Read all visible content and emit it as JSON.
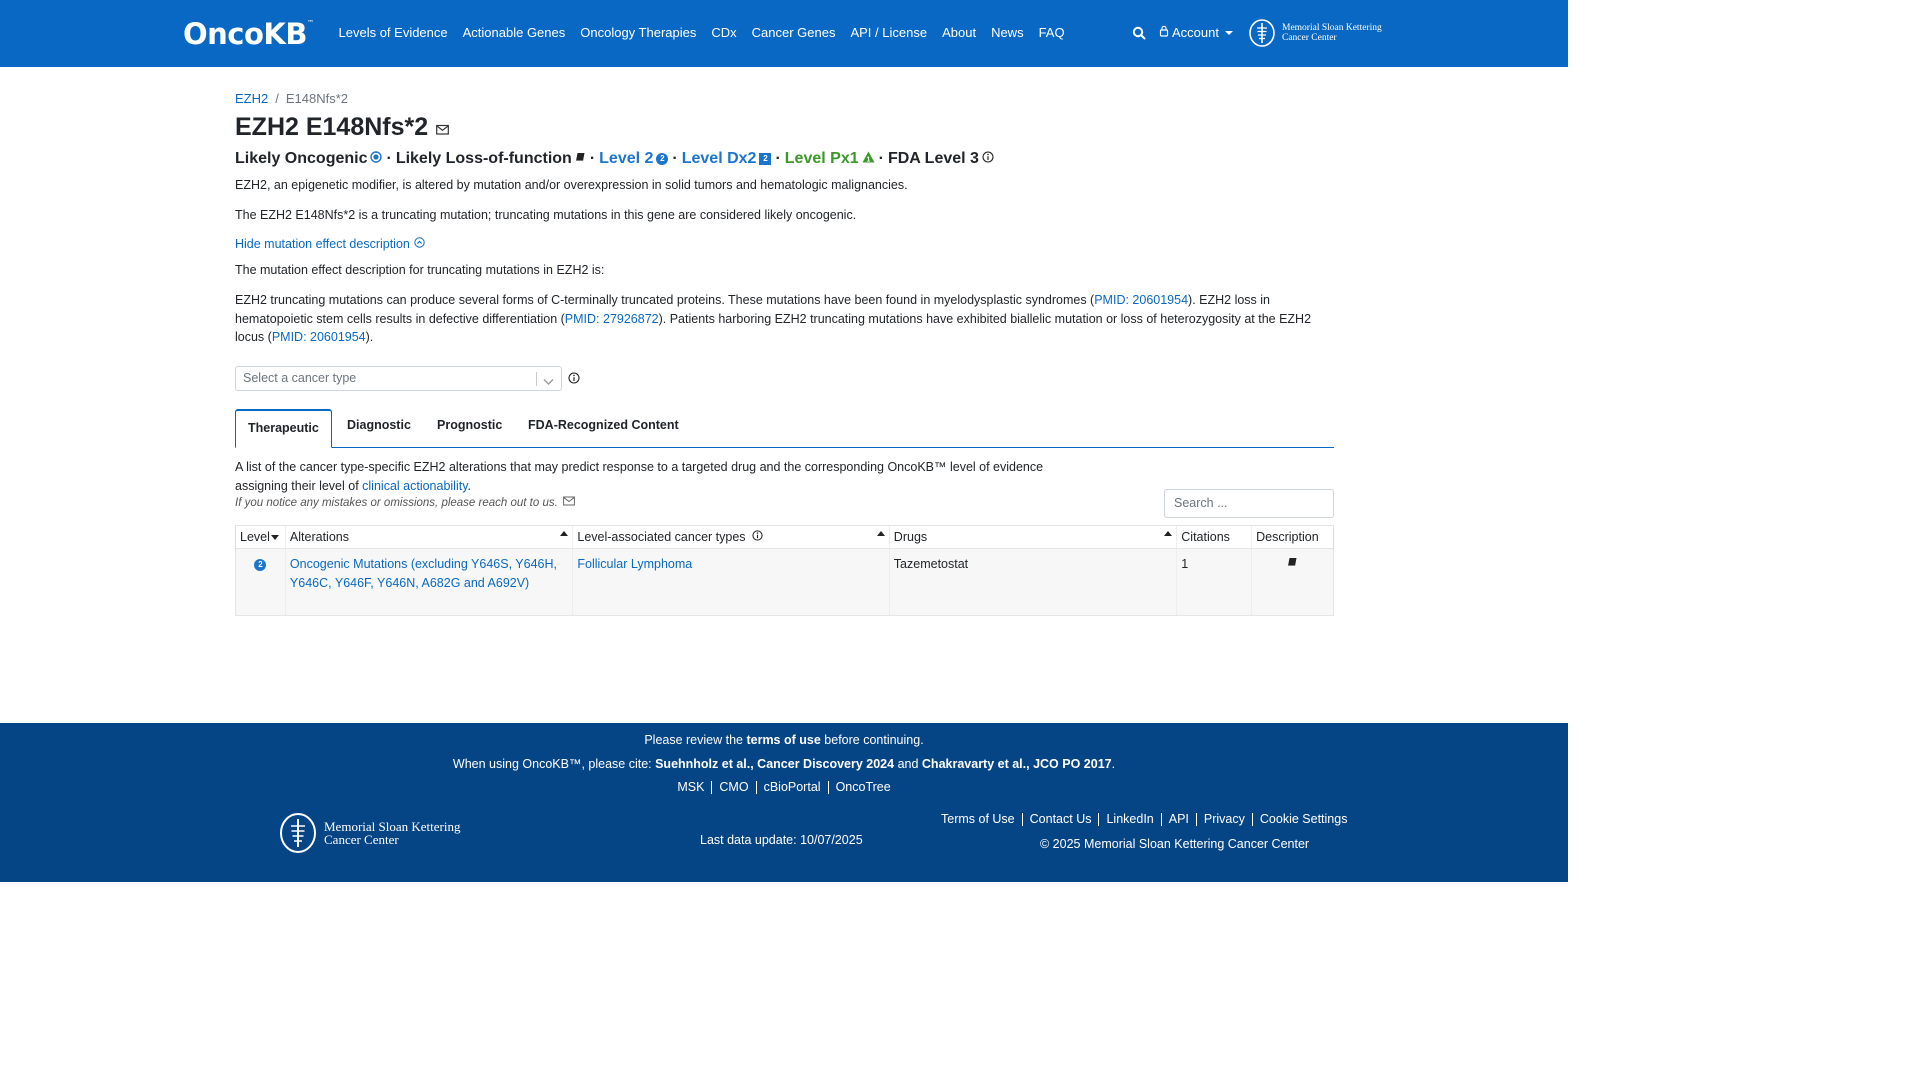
{
  "header": {
    "logo_text": "OncoKB",
    "logo_tm": "™",
    "nav": [
      "Levels of Evidence",
      "Actionable Genes",
      "Oncology Therapies",
      "CDx",
      "Cancer Genes",
      "API / License",
      "About",
      "News",
      "FAQ"
    ],
    "account_label": "Account",
    "msk_line1": "Memorial Sloan Kettering",
    "msk_line2": "Cancer Center"
  },
  "breadcrumb": {
    "gene": "EZH2",
    "separator": "/",
    "alteration": "E148Nfs*2"
  },
  "title": "EZH2 E148Nfs*2",
  "badges": {
    "oncogenic": "Likely Oncogenic",
    "effect": "Likely Loss-of-function",
    "dot": "·",
    "level2": "Level 2",
    "level2_num": "2",
    "leveldx2": "Level Dx2",
    "leveldx2_num": "2",
    "levelpx1": "Level Px1",
    "fda": "FDA Level 3"
  },
  "summary": {
    "gene": "EZH2, an epigenetic modifier, is altered by mutation and/or overexpression in solid tumors and hematologic malignancies.",
    "variant": "The EZH2 E148Nfs*2 is a truncating mutation; truncating mutations in this gene are considered likely oncogenic.",
    "hide_link": "Hide mutation effect description",
    "effect_intro": "The mutation effect description for truncating mutations in EZH2 is:",
    "effect_a": "EZH2 truncating mutations can produce several forms of C-terminally truncated proteins. These mutations have been found in myelodysplastic syndromes (",
    "pmid1": "PMID: 20601954",
    "effect_b": "). EZH2 loss in hematopoietic stem cells results in defective differentiation (",
    "pmid2": "PMID: 27926872",
    "effect_c": "). Patients harboring EZH2 truncating mutations have exhibited biallelic mutation or loss of heterozygosity at the EZH2 locus (",
    "pmid3": "PMID: 20601954",
    "effect_d": ")."
  },
  "cancer_select": {
    "placeholder": "Select a cancer type"
  },
  "tabs": [
    "Therapeutic",
    "Diagnostic",
    "Prognostic",
    "FDA-Recognized Content"
  ],
  "tab_content": {
    "desc_a": "A list of the cancer type-specific EZH2 alterations that may predict response to a targeted drug and the corresponding OncoKB™ level of evidence assigning their level of ",
    "desc_link": "clinical actionability",
    "desc_b": ".",
    "note": "If you notice any mistakes or omissions, please reach out to us.",
    "search_placeholder": "Search ..."
  },
  "table": {
    "headers": [
      "Level",
      "Alterations",
      "Level-associated cancer types",
      "Drugs",
      "Citations",
      "Description"
    ],
    "rows": [
      {
        "level": "2",
        "alterations": "Oncogenic Mutations (excluding Y646S, Y646H, Y646C, Y646F, Y646N, A682G and A692V)",
        "cancer_type": "Follicular Lymphoma",
        "drugs": "Tazemetostat",
        "citations": "1"
      }
    ]
  },
  "footer": {
    "review_a": "Please review the ",
    "review_b": "terms of use",
    "review_c": " before continuing.",
    "cite_a": "When using OncoKB™, please cite: ",
    "cite_b": "Suehnholz et al., Cancer Discovery 2024",
    "cite_c": " and ",
    "cite_d": "Chakravarty et al., JCO PO 2017",
    "cite_e": ".",
    "links": [
      "MSK",
      "CMO",
      "cBioPortal",
      "OncoTree"
    ],
    "msk_line1": "Memorial Sloan Kettering",
    "msk_line2": "Cancer Center",
    "last_update": "Last data update: 10/07/2025",
    "right_links": [
      "Terms of Use",
      "Contact Us",
      "LinkedIn",
      "API",
      "Privacy",
      "Cookie Settings"
    ],
    "copyright": "© 2025 Memorial Sloan Kettering Cancer Center"
  },
  "colors": {
    "primary": "#0968c3",
    "footer": "#064585",
    "level2": "#1c75cd",
    "px1": "#3a9a27"
  }
}
